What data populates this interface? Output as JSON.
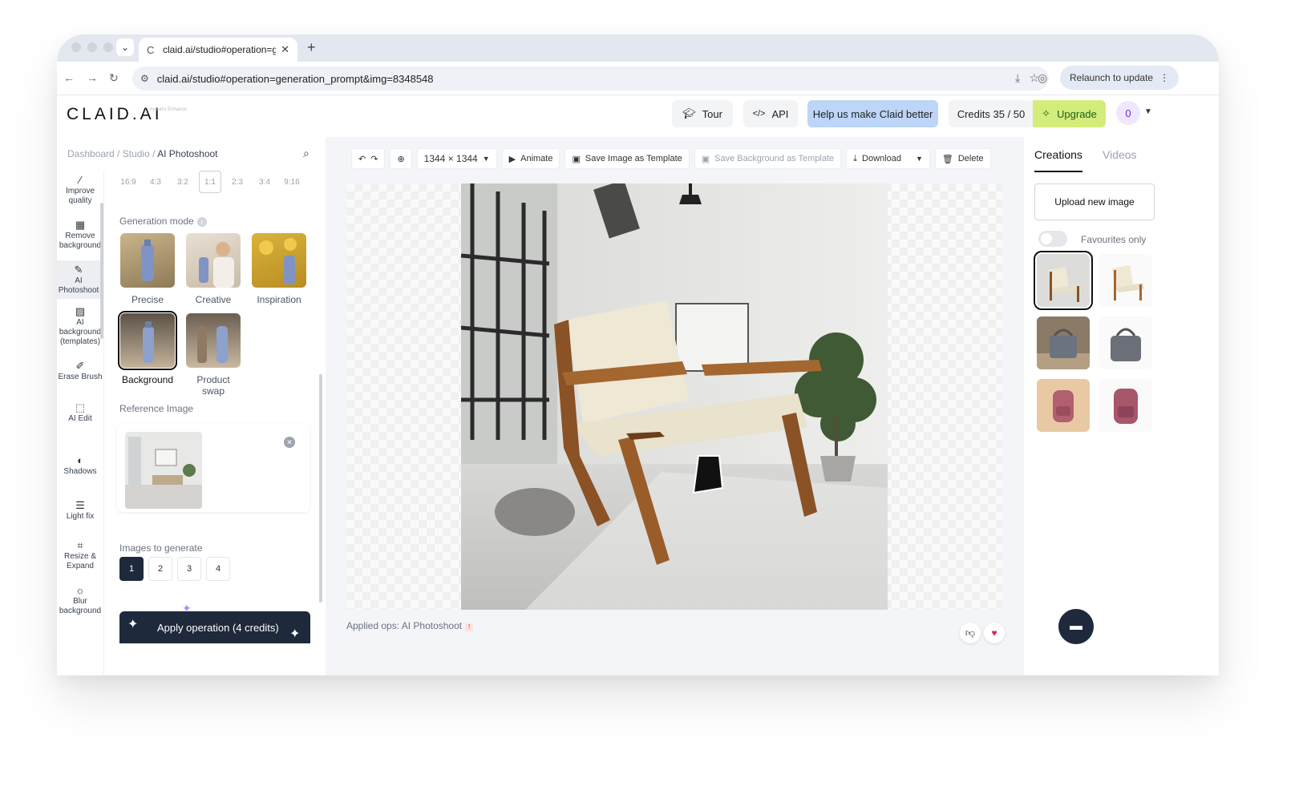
{
  "browser": {
    "tab_title": "claid.ai/studio#operation=ge",
    "url": "claid.ai/studio#operation=generation_prompt&img=8348548",
    "relaunch_label": "Relaunch to update"
  },
  "header": {
    "logo": "CLAID.AI",
    "logo_by": "by Let's Enhance",
    "tour": "Tour",
    "api": "API",
    "help": "Help us make Claid better",
    "credits": "Credits 35 / 50",
    "upgrade": "Upgrade",
    "avatar": "0"
  },
  "breadcrumb": {
    "dashboard": "Dashboard",
    "studio": "Studio",
    "current": "AI Photoshoot"
  },
  "tools": [
    {
      "label": "Improve quality",
      "icon": "wand-icon"
    },
    {
      "label": "Remove background",
      "icon": "checker-icon"
    },
    {
      "label": "AI Photoshoot",
      "icon": "pencil-icon"
    },
    {
      "label": "AI background (templates)",
      "icon": "image-icon"
    },
    {
      "label": "Erase Brush",
      "icon": "brush-icon"
    },
    {
      "label": "AI Edit",
      "icon": "sparkle-edit-icon"
    },
    {
      "label": "Shadows",
      "icon": "shadow-icon"
    },
    {
      "label": "Light fix",
      "icon": "sliders-icon"
    },
    {
      "label": "Resize & Expand",
      "icon": "crop-icon"
    },
    {
      "label": "Blur background",
      "icon": "blur-icon"
    }
  ],
  "ratios": [
    "16:9",
    "4:3",
    "3:2",
    "1:1",
    "2:3",
    "3:4",
    "9:16"
  ],
  "selected_ratio": "1:1",
  "generation_mode": {
    "label": "Generation mode",
    "modes": [
      "Precise",
      "Creative",
      "Inspiration",
      "Background",
      "Product swap"
    ],
    "selected": "Background"
  },
  "reference": {
    "label": "Reference Image"
  },
  "images_to_generate": {
    "label": "Images to generate",
    "options": [
      "1",
      "2",
      "3",
      "4"
    ],
    "selected": "1"
  },
  "apply_label": "Apply operation (4 credits)",
  "toolbar": {
    "size": "1344 × 1344",
    "animate": "Animate",
    "save_template": "Save Image as Template",
    "save_bg_template": "Save Background as Template",
    "download": "Download",
    "delete": "Delete"
  },
  "applied_ops": "Applied ops: AI Photoshoot",
  "right": {
    "tab_creations": "Creations",
    "tab_videos": "Videos",
    "upload": "Upload new image",
    "favourites": "Favourites only"
  },
  "colors": {
    "accent_blue": "#bdd5f7",
    "upgrade_green": "#d4ed7a",
    "dark": "#1e293b"
  }
}
